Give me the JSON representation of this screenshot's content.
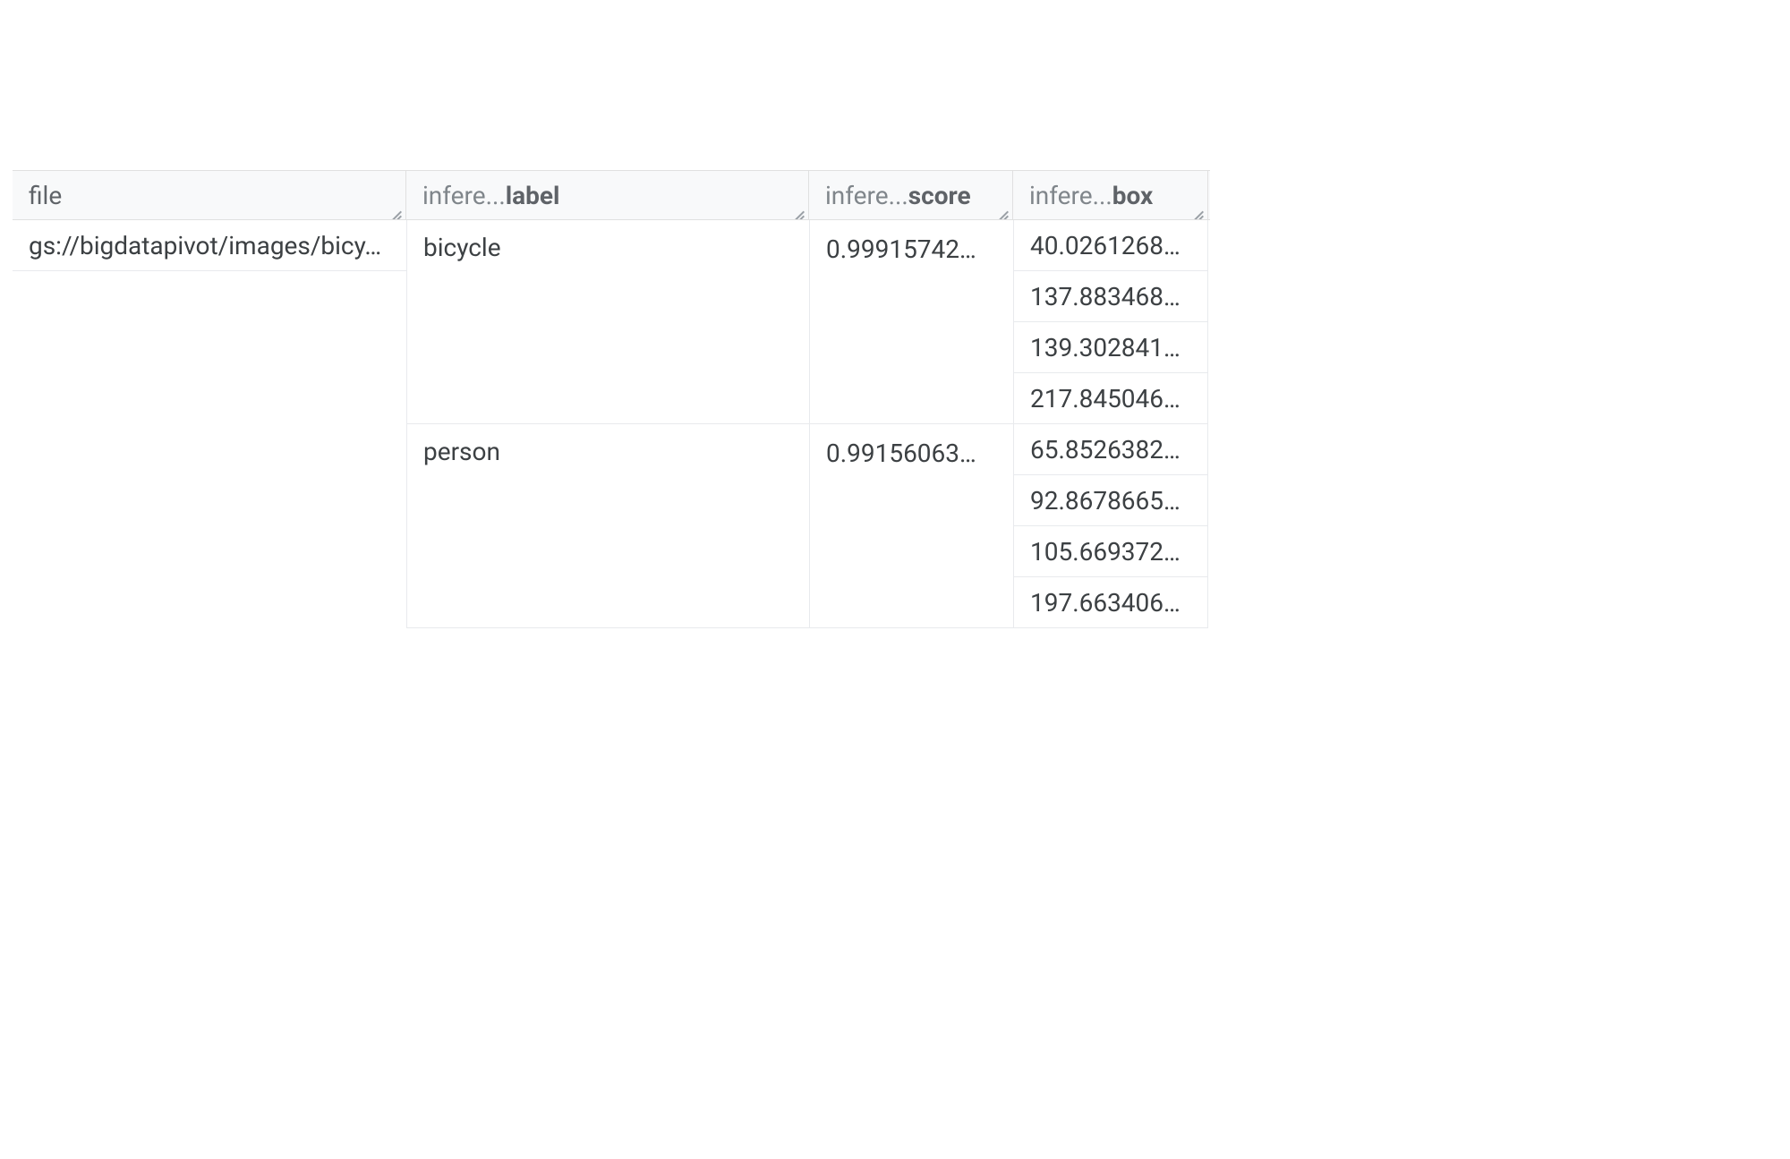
{
  "columns": {
    "file": {
      "label": "file"
    },
    "label": {
      "prefix": "infere...",
      "suffix": "label"
    },
    "score": {
      "prefix": "infere...",
      "suffix": "score"
    },
    "box": {
      "prefix": "infere...",
      "suffix": "box"
    }
  },
  "row": {
    "file": "gs://bigdatapivot/images/bicy…",
    "inferences": [
      {
        "label": "bicycle",
        "score": "0.99915742…",
        "box": [
          "40.0261268…",
          "137.883468…",
          "139.302841…",
          "217.845046…"
        ]
      },
      {
        "label": "person",
        "score": "0.99156063…",
        "box": [
          "65.8526382…",
          "92.8678665…",
          "105.669372…",
          "197.663406…"
        ]
      }
    ]
  }
}
